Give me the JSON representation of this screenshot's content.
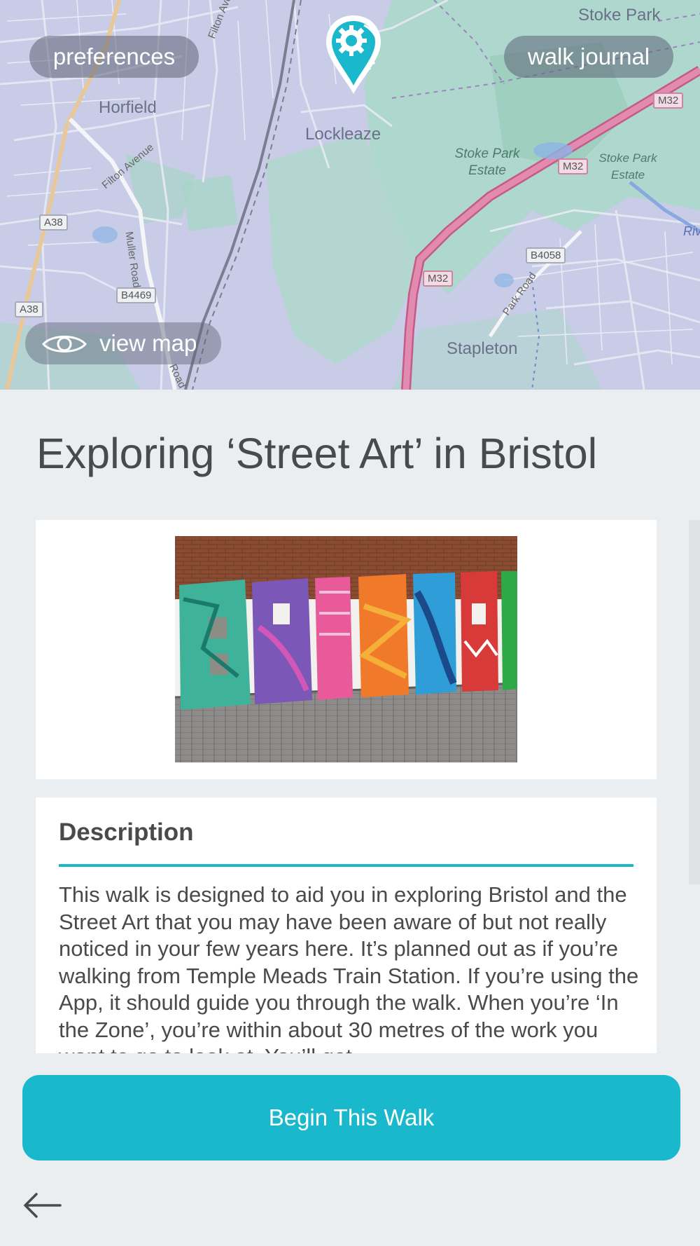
{
  "header": {
    "preferences_label": "preferences",
    "journal_label": "walk journal",
    "view_map_label": "view map"
  },
  "map": {
    "places": [
      "Stoke Park",
      "Horfield",
      "Lockleaze",
      "Stoke Park Estate",
      "Stoke Park Estate",
      "Stapleton",
      "Riv"
    ],
    "roads": [
      "Filton Ave",
      "Filton Avenue",
      "Muller Road",
      "Park Road",
      "Road"
    ],
    "shields": [
      "A38",
      "A38",
      "B4469",
      "B4058",
      "M32",
      "M32",
      "M32"
    ]
  },
  "walk": {
    "title": "Exploring ‘Street Art’ in Bristol",
    "image_text": "BRISTOL"
  },
  "description": {
    "heading": "Description",
    "body": "This walk is designed to aid you in exploring Bristol and the Street Art that you may have been aware of but not really noticed in your few years here. It’s planned out as if you’re walking from Temple Meads Train Station. If you’re using the App, it should guide you through the walk. When you’re ‘In the Zone’, you’re within about 30 metres of the work you want to go to look at. You’ll get"
  },
  "actions": {
    "begin_label": "Begin This Walk"
  },
  "colors": {
    "accent": "#1ab8cc",
    "background": "#eaeef0",
    "text": "#4a4a4a"
  }
}
